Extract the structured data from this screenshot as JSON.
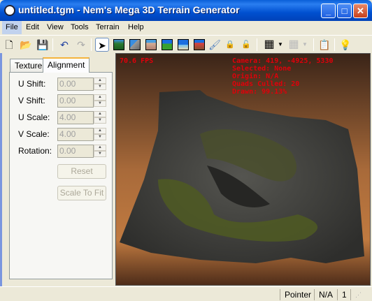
{
  "window": {
    "title": "untitled.tgm - Nem's Mega 3D Terrain Generator",
    "minimize": "_",
    "maximize": "□",
    "close": "✕"
  },
  "menu": [
    "File",
    "Edit",
    "View",
    "Tools",
    "Terrain",
    "Help"
  ],
  "toolbar": {
    "icons": [
      "new-file-icon",
      "open-folder-icon",
      "save-icon",
      "undo-icon",
      "redo-icon",
      "pointer-icon",
      "terrain-forest-icon",
      "terrain-mountain-icon",
      "terrain-rock-icon",
      "terrain-hills-icon",
      "terrain-water-icon",
      "terrain-volcano-icon",
      "brush-icon",
      "lock-icon",
      "unlock-icon",
      "grid-icon",
      "grid-disabled-icon",
      "properties-icon",
      "lightbulb-icon"
    ]
  },
  "tabs": [
    "Texture",
    "Alignment"
  ],
  "alignment": {
    "fields": [
      {
        "label": "U Shift:",
        "value": "0.00"
      },
      {
        "label": "V Shift:",
        "value": "0.00"
      },
      {
        "label": "U Scale:",
        "value": "4.00"
      },
      {
        "label": "V Scale:",
        "value": "4.00"
      },
      {
        "label": "Rotation:",
        "value": "0.00"
      }
    ],
    "reset": "Reset",
    "scale_to_fit": "Scale To Fit"
  },
  "viewport": {
    "fps": "70.6 FPS",
    "camera": "Camera: 419, -4925, 5330",
    "selected": "Selected: None",
    "origin": "Origin: N/A",
    "quads": "Quads Culled: 20",
    "drawn": "Drawn: 99.13%",
    "hud_color": "#e0000a"
  },
  "status": {
    "mode": "Pointer",
    "value": "N/A",
    "count": "1"
  }
}
